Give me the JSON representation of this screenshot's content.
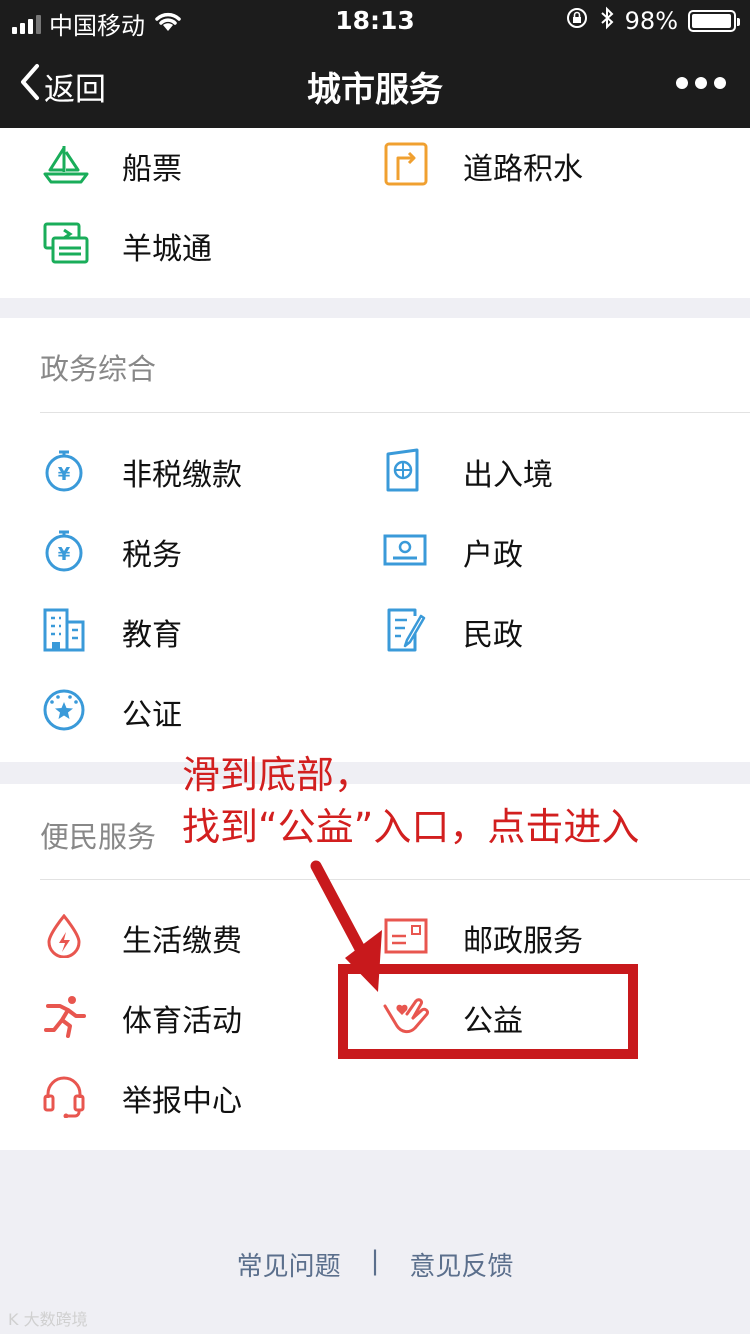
{
  "status": {
    "carrier": "中国移动",
    "time": "18:13",
    "battery": "98%",
    "battery_level": 0.98
  },
  "nav": {
    "back": "返回",
    "title": "城市服务"
  },
  "top_section": {
    "items": [
      {
        "label": "船票",
        "icon": "boat-icon"
      },
      {
        "label": "道路积水",
        "icon": "road-sign-icon"
      },
      {
        "label": "羊城通",
        "icon": "card-transfer-icon"
      }
    ]
  },
  "gov_section": {
    "title": "政务综合",
    "items": [
      {
        "label": "非税缴款",
        "icon": "yuan-stopwatch-icon"
      },
      {
        "label": "出入境",
        "icon": "passport-icon"
      },
      {
        "label": "税务",
        "icon": "yuan-stopwatch-icon"
      },
      {
        "label": "户政",
        "icon": "id-card-icon"
      },
      {
        "label": "教育",
        "icon": "building-icon"
      },
      {
        "label": "民政",
        "icon": "document-edit-icon"
      },
      {
        "label": "公证",
        "icon": "emblem-icon"
      }
    ]
  },
  "people_section": {
    "title": "便民服务",
    "items": [
      {
        "label": "生活缴费",
        "icon": "water-drop-bolt-icon"
      },
      {
        "label": "邮政服务",
        "icon": "postal-card-icon"
      },
      {
        "label": "体育活动",
        "icon": "runner-icon"
      },
      {
        "label": "公益",
        "icon": "helping-hand-heart-icon"
      },
      {
        "label": "举报中心",
        "icon": "headset-icon"
      }
    ]
  },
  "annotation": {
    "line1": "滑到底部，",
    "line2": "找到“公益”入口，点击进入"
  },
  "footer": {
    "faq": "常见问题",
    "separator": "|",
    "feedback": "意见反馈"
  },
  "watermark": "K 大数跨境",
  "colors": {
    "green": "#1aad5a",
    "orange": "#f0a030",
    "blue": "#3a9ad9",
    "red": "#e8564f",
    "annotation_red": "#c8191c"
  }
}
